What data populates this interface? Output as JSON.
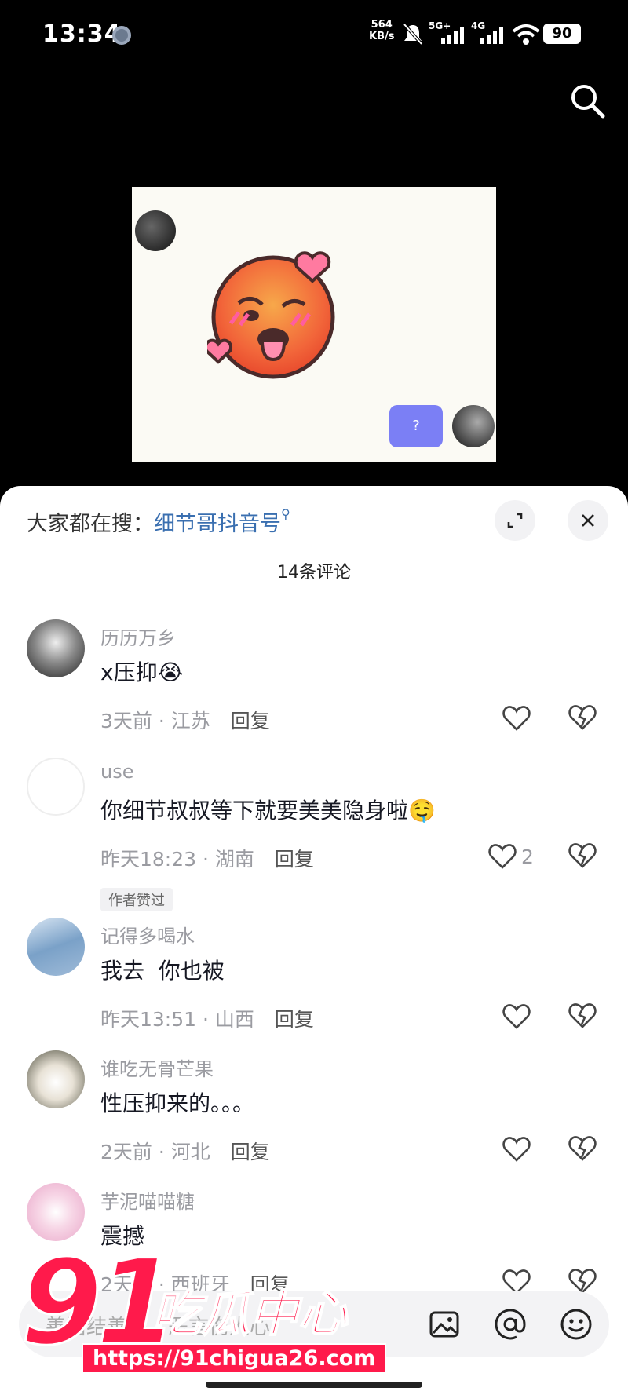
{
  "status_bar": {
    "time": "13:34",
    "net_speed_value": "564",
    "net_speed_unit": "KB/s",
    "sig1": "5G+",
    "sig2": "4G",
    "battery": "90"
  },
  "video": {
    "question_button": "?"
  },
  "sheet": {
    "search_prefix": "大家都在搜：",
    "search_keyword": "细节哥抖音号",
    "comment_count": "14条评论",
    "reply_label": "回复",
    "comments": [
      {
        "user": "历历万乡",
        "text": "x压抑",
        "emoji": "😭",
        "time": "3天前",
        "location": "江苏",
        "likes": ""
      },
      {
        "user": "use",
        "text": "你细节叔叔等下就要美美隐身啦",
        "emoji": "🤤",
        "time": "昨天18:23",
        "location": "湖南",
        "likes": "2",
        "badge": "作者赞过"
      },
      {
        "user": "记得多喝水",
        "text": "我去  你也被",
        "emoji": "",
        "time": "昨天13:51",
        "location": "山西",
        "likes": ""
      },
      {
        "user": "谁吃无骨芒果",
        "text": "性压抑来的。。。",
        "emoji": "",
        "time": "2天前",
        "location": "河北",
        "likes": ""
      },
      {
        "user": "芋泥喵喵糖",
        "text": "震撼",
        "emoji": "",
        "time": "2天前",
        "location": "西班牙",
        "likes": ""
      }
    ]
  },
  "input_bar": {
    "placeholder": "善语结善缘，恶言伤人心"
  },
  "watermark": {
    "number": "91",
    "title": "吃瓜中心",
    "url": "https://91chigua26.com"
  },
  "icons": {
    "top_search": "search-icon",
    "expand": "expand-icon",
    "close": "close-icon",
    "like": "heart-icon",
    "dislike": "broken-heart-icon",
    "image": "image-icon",
    "mention": "at-icon",
    "emoji": "emoji-icon"
  },
  "colors": {
    "keyword": "#3a6fb0",
    "question_button": "#7b7ff5",
    "watermark": "#ff1a4b"
  }
}
